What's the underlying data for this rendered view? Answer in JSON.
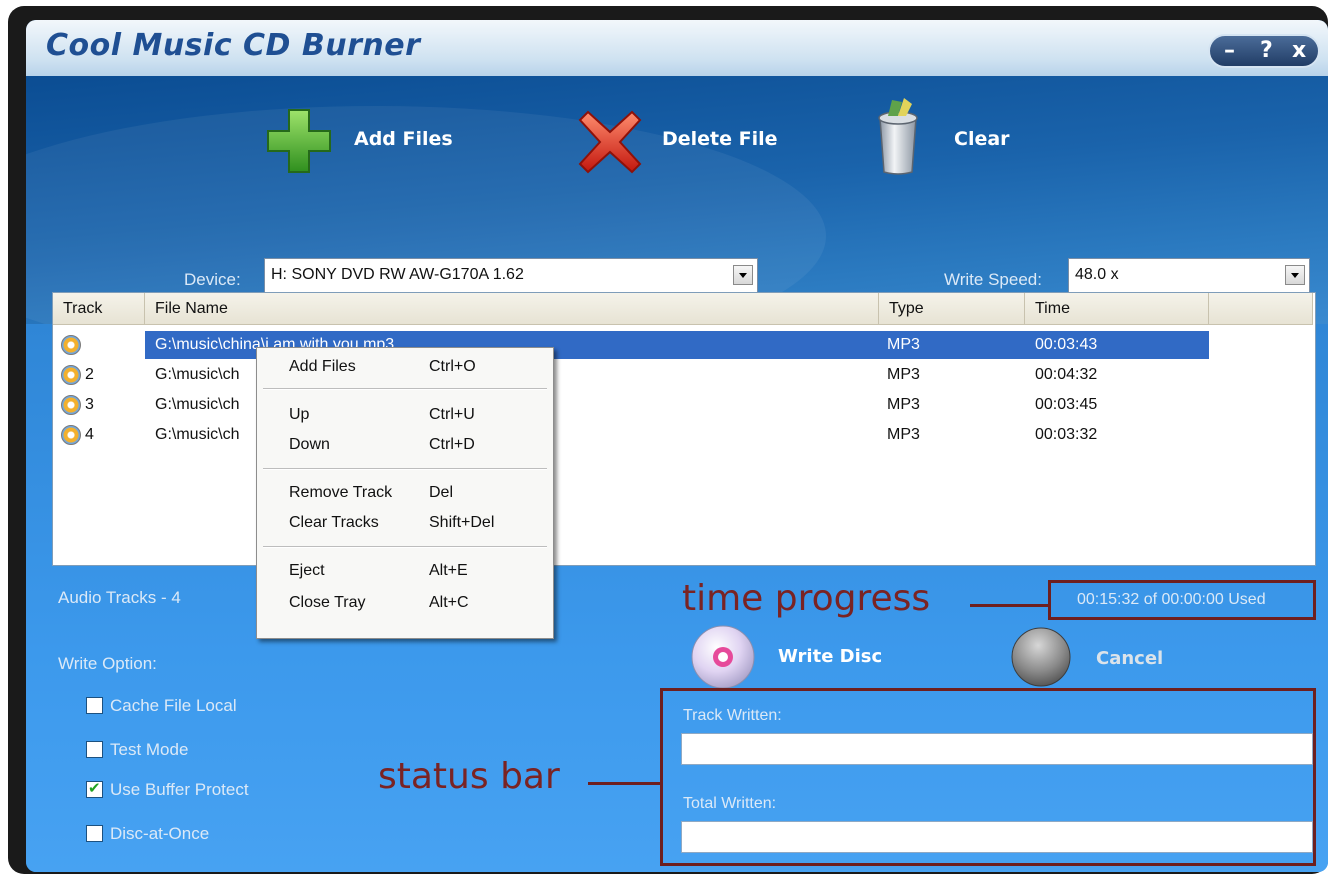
{
  "window": {
    "title": "Cool Music CD Burner",
    "controls": {
      "minimize": "–",
      "help": "?",
      "close": "x"
    }
  },
  "toolbar": {
    "add_files": "Add Files",
    "delete_file": "Delete File",
    "clear": "Clear"
  },
  "device": {
    "label": "Device:",
    "value": "H: SONY DVD RW AW-G170A 1.62"
  },
  "write_speed": {
    "label": "Write Speed:",
    "value": "48.0 x"
  },
  "track_list": {
    "columns": [
      "Track",
      "File Name",
      "Type",
      "Time"
    ],
    "rows": [
      {
        "track": "1",
        "file": "G:\\music\\china\\i am with you.mp3",
        "type": "MP3",
        "time": "00:03:43",
        "selected": true
      },
      {
        "track": "2",
        "file": "G:\\music\\ch",
        "type": "MP3",
        "time": "00:04:32"
      },
      {
        "track": "3",
        "file": "G:\\music\\ch",
        "type": "MP3",
        "time": "00:03:45"
      },
      {
        "track": "4",
        "file": "G:\\music\\ch",
        "type": "MP3",
        "time": "00:03:32"
      }
    ]
  },
  "context_menu": {
    "items": [
      {
        "label": "Add Files",
        "shortcut": "Ctrl+O"
      },
      {
        "label": "Up",
        "shortcut": "Ctrl+U"
      },
      {
        "label": "Down",
        "shortcut": "Ctrl+D"
      },
      {
        "label": "Remove Track",
        "shortcut": "Del"
      },
      {
        "label": "Clear Tracks",
        "shortcut": "Shift+Del"
      },
      {
        "label": "Eject",
        "shortcut": "Alt+E"
      },
      {
        "label": "Close Tray",
        "shortcut": "Alt+C"
      }
    ]
  },
  "audio_tracks": "Audio Tracks - 4",
  "time_progress": "00:15:32 of 00:00:00 Used",
  "write_options": {
    "label": "Write Option:",
    "options": [
      {
        "label": "Cache File Local",
        "checked": false
      },
      {
        "label": "Test Mode",
        "checked": false
      },
      {
        "label": "Use Buffer Protect",
        "checked": true
      },
      {
        "label": "Disc-at-Once",
        "checked": false
      }
    ]
  },
  "actions": {
    "write_disc": "Write Disc",
    "cancel": "Cancel"
  },
  "status": {
    "track_written_label": "Track Written:",
    "total_written_label": "Total Written:"
  },
  "annotations": {
    "time_progress": "time progress",
    "status_bar": "status bar"
  },
  "colors": {
    "title_text": "#1f4f93",
    "selection": "#316ac5",
    "annotation": "#7a2323"
  }
}
